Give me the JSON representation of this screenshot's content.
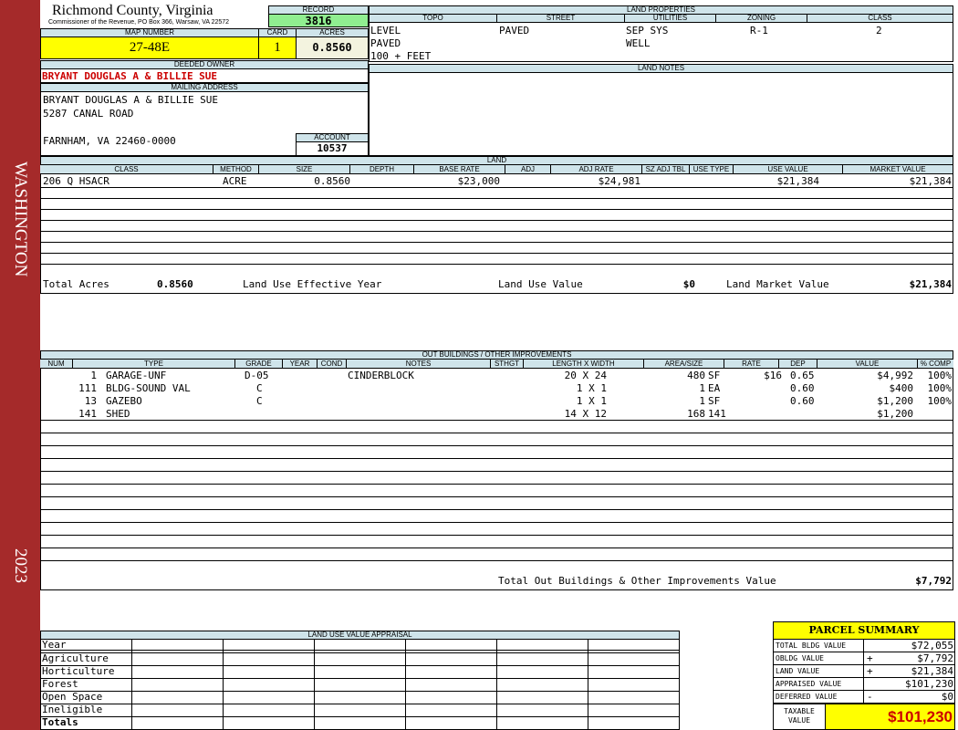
{
  "sidebar": {
    "district": "WASHINGTON",
    "year": "2023"
  },
  "header": {
    "county": "Richmond County, Virginia",
    "commissioner": "Commissioner of the Revenue, PO Box 366, Warsaw, VA 22572",
    "record_label": "RECORD",
    "record": "3816",
    "map_label": "MAP NUMBER",
    "map_number": "27-48E",
    "card_label": "CARD",
    "card": "1",
    "acres_label": "ACRES",
    "acres": "0.8560"
  },
  "land_properties": {
    "title": "LAND PROPERTIES",
    "headers": [
      "TOPO",
      "STREET",
      "UTILITIES",
      "ZONING",
      "CLASS"
    ],
    "topo": [
      "LEVEL",
      "PAVED",
      "100 + FEET"
    ],
    "street": [
      "PAVED"
    ],
    "utilities": [
      "SEP SYS",
      "WELL"
    ],
    "zoning": [
      "R-1"
    ],
    "class": [
      "2"
    ]
  },
  "land_notes": {
    "title": "LAND NOTES"
  },
  "owner": {
    "deeded_label": "DEEDED OWNER",
    "deeded_owner": "BRYANT DOUGLAS A & BILLIE SUE",
    "mailing_label": "MAILING ADDRESS",
    "mailing": [
      "BRYANT DOUGLAS A & BILLIE SUE",
      "5287 CANAL ROAD",
      "",
      "FARNHAM, VA 22460-0000"
    ],
    "account_label": "ACCOUNT",
    "account": "10537"
  },
  "land": {
    "title": "LAND",
    "headers": [
      "CLASS",
      "METHOD",
      "SIZE",
      "DEPTH",
      "BASE RATE",
      "ADJ",
      "ADJ RATE",
      "SZ ADJ TBL",
      "USE TYPE",
      "USE VALUE",
      "MARKET VALUE"
    ],
    "rows": [
      {
        "class": "206 Q HSACR",
        "method": "ACRE",
        "size": "0.8560",
        "depth": "",
        "base_rate": "$23,000",
        "adj": "",
        "adj_rate": "$24,981",
        "sz_adj": "",
        "use_type": "",
        "use_value": "$21,384",
        "market_value": "$21,384"
      }
    ],
    "total_acres_label": "Total Acres",
    "total_acres": "0.8560",
    "effective_year_label": "Land Use Effective Year",
    "use_value_label": "Land Use Value",
    "use_value": "$0",
    "market_value_label": "Land Market Value",
    "market_value": "$21,384"
  },
  "outbuildings": {
    "title": "OUT BUILDINGS / OTHER IMPROVEMENTS",
    "headers": [
      "NUM",
      "TYPE",
      "GRADE",
      "YEAR",
      "COND",
      "NOTES",
      "STHGT",
      "LENGTH X WIDTH",
      "AREA/SIZE",
      "RATE",
      "DEP",
      "VALUE",
      "% COMP"
    ],
    "rows": [
      {
        "num": "1",
        "type": "GARAGE-UNF",
        "grade": "D-05",
        "year": "",
        "cond": "",
        "notes": "CINDERBLOCK",
        "sthgt": "",
        "lw": "20 X 24",
        "area": "480",
        "unit": "SF",
        "rate": "$16",
        "dep": "0.65",
        "value": "$4,992",
        "comp": "100%"
      },
      {
        "num": "111",
        "type": "BLDG-SOUND VAL",
        "grade": "C",
        "year": "",
        "cond": "",
        "notes": "",
        "sthgt": "",
        "lw": "1 X 1",
        "area": "1",
        "unit": "EA",
        "rate": "",
        "dep": "0.60",
        "value": "$400",
        "comp": "100%"
      },
      {
        "num": "13",
        "type": "GAZEBO",
        "grade": "C",
        "year": "",
        "cond": "",
        "notes": "",
        "sthgt": "",
        "lw": "1 X 1",
        "area": "1",
        "unit": "SF",
        "rate": "",
        "dep": "0.60",
        "value": "$1,200",
        "comp": "100%"
      },
      {
        "num": "141",
        "type": "SHED",
        "grade": "",
        "year": "",
        "cond": "",
        "notes": "",
        "sthgt": "",
        "lw": "14 X 12",
        "area": "168",
        "unit": "141",
        "rate": "",
        "dep": "",
        "value": "$1,200",
        "comp": ""
      }
    ],
    "total_label": "Total Out Buildings & Other Improvements Value",
    "total": "$7,792"
  },
  "land_use": {
    "title": "LAND USE VALUE APPRAISAL",
    "rows": [
      "Year",
      "Agriculture",
      "Horticulture",
      "Forest",
      "Open Space",
      "Ineligible",
      "Totals"
    ]
  },
  "summary": {
    "title": "PARCEL SUMMARY",
    "rows": [
      {
        "label": "TOTAL BLDG VALUE",
        "sign": "",
        "value": "$72,055"
      },
      {
        "label": "OBLDG VALUE",
        "sign": "+",
        "value": "$7,792"
      },
      {
        "label": "LAND VALUE",
        "sign": "+",
        "value": "$21,384"
      },
      {
        "label": "APPRAISED VALUE",
        "sign": "",
        "value": "$101,230"
      },
      {
        "label": "DEFERRED VALUE",
        "sign": "-",
        "value": "$0"
      }
    ],
    "taxable_label": "TAXABLE VALUE",
    "taxable": "$101,230"
  },
  "colors": {
    "sidebar": "#a52a2a",
    "header_fill": "#cfe4ea",
    "highlight": "#ffff00",
    "record_fill": "#90ee90",
    "owner_red": "#cc0000"
  }
}
